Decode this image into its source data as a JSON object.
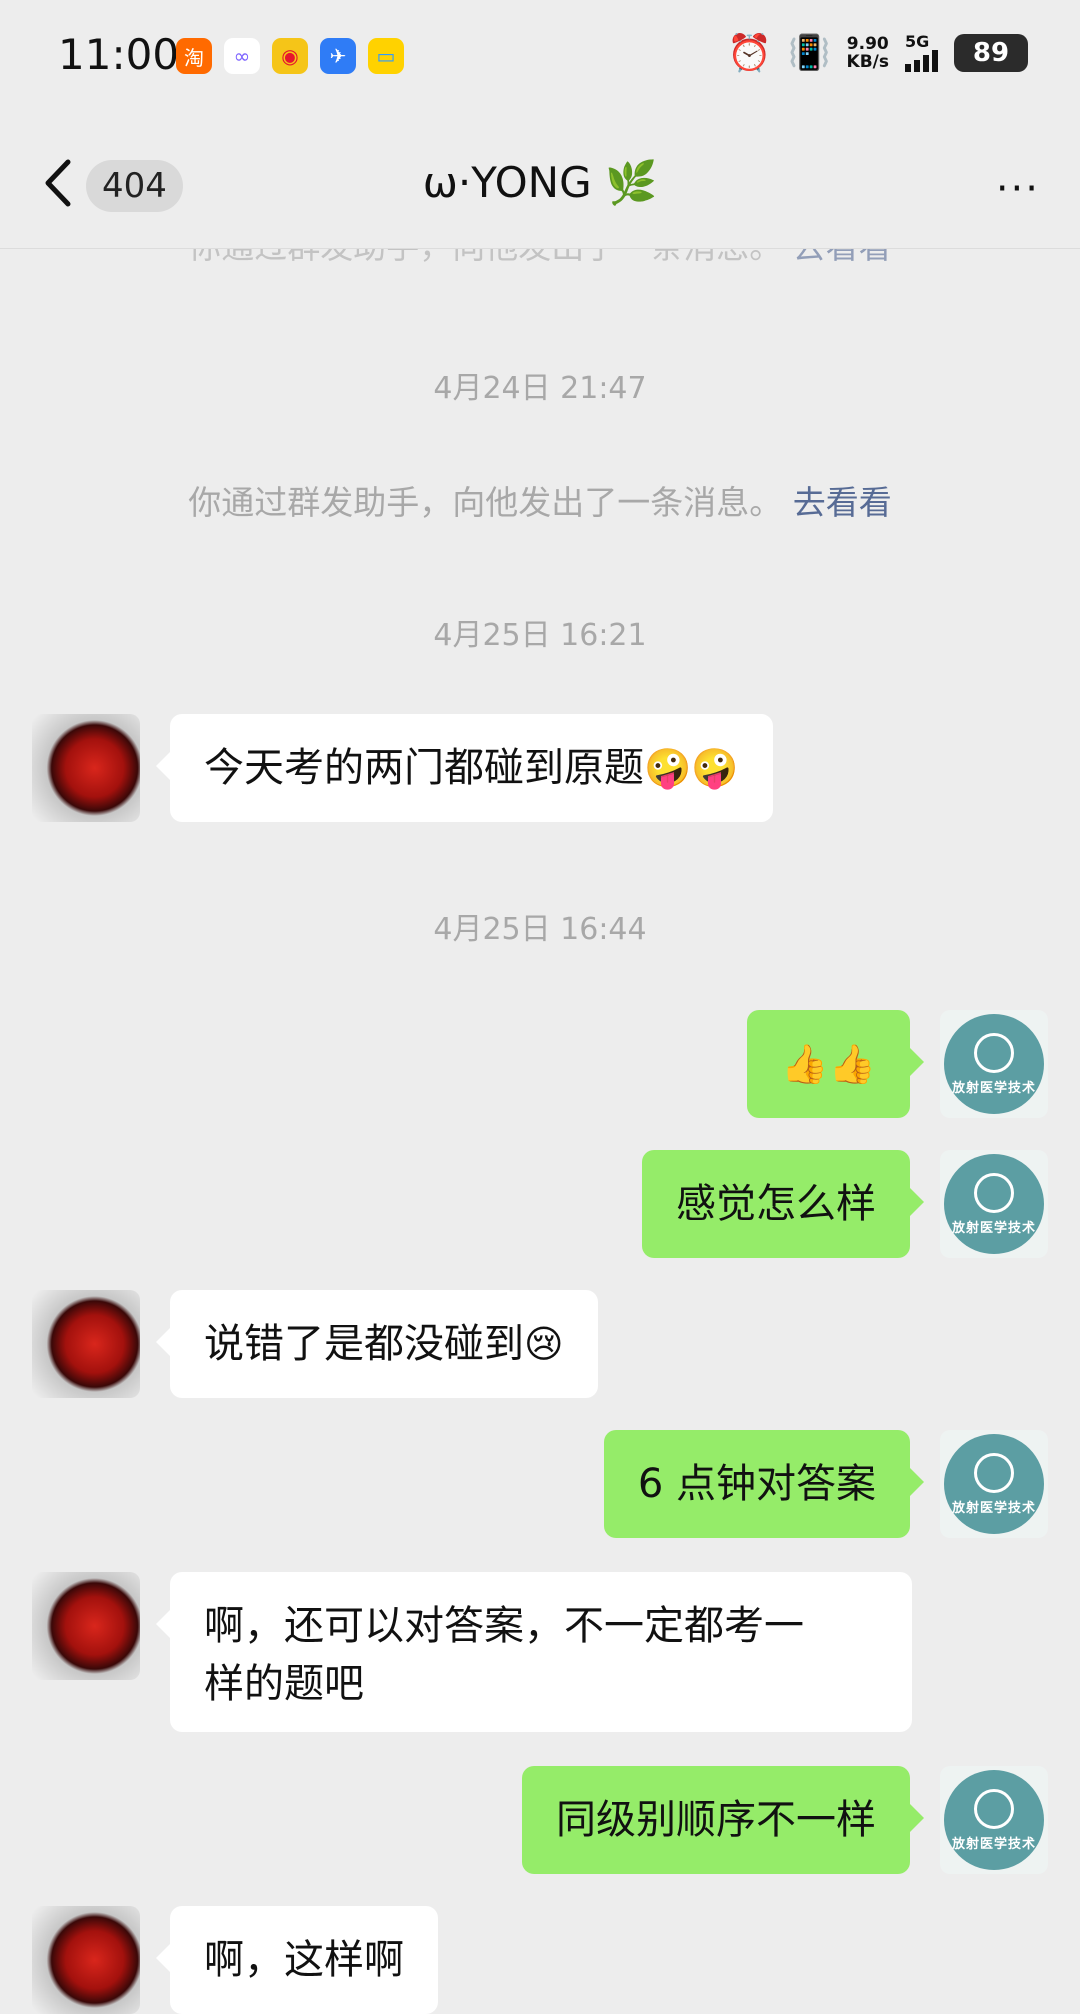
{
  "status_bar": {
    "time": "11:00",
    "app_icons": [
      {
        "icon": "taobao-icon",
        "glyph": "淘",
        "color": "#ff6a00"
      },
      {
        "icon": "clouds-icon",
        "glyph": "∞",
        "color": "#ffffff"
      },
      {
        "icon": "weibo-icon",
        "glyph": "◉",
        "color": "#f5c518"
      },
      {
        "icon": "bird-icon",
        "glyph": "✈",
        "color": "#2f7cf6"
      },
      {
        "icon": "card-icon",
        "glyph": "▭",
        "color": "#ffd200"
      }
    ],
    "net_speed": "9.90",
    "net_unit": "KB/s",
    "network": "5G",
    "battery": "89"
  },
  "nav": {
    "unread_count": "404",
    "title": "ω·YONG 🌿",
    "more": "···"
  },
  "messages": {
    "sys_top_partial": "你通过群发助手，向他发出了一条消息。",
    "sys_top_partial_link": "去看看",
    "ts1": "4月24日 21:47",
    "sys1": "你通过群发助手，向他发出了一条消息。",
    "sys1_link": "去看看",
    "ts2": "4月25日 16:21",
    "m1": "今天考的两门都碰到原题",
    "m1_emoji": "🤪🤪",
    "ts3": "4月25日 16:44",
    "m2": "👍👍",
    "m3": "感觉怎么样",
    "m4": "说错了是都没碰到",
    "m4_emoji": "😢",
    "m5": "6 点钟对答案",
    "m6_line1": "啊，还可以对答案，不一定都考一",
    "m6_line2": "样的题吧",
    "m7": "同级别顺序不一样",
    "m8": "啊，这样啊"
  },
  "avatar_right_text": "放射医学技术",
  "colors": {
    "background": "#ededed",
    "self_bubble": "#95ec69",
    "other_bubble": "#ffffff",
    "link": "#576b95"
  }
}
